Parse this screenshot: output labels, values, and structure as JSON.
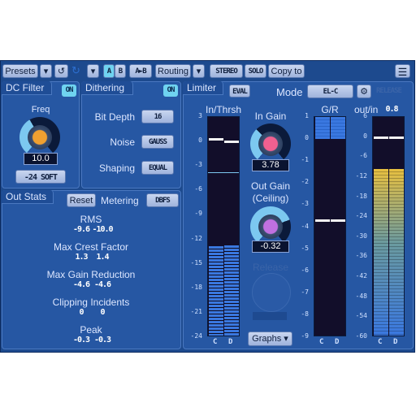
{
  "toolbar": {
    "presets": "Presets",
    "a": "A",
    "b": "B",
    "ab": "A►B",
    "routing": "Routing",
    "stereo": "STEREO",
    "solo": "SOLO",
    "copy_to": "Copy to"
  },
  "dc_filter": {
    "title": "DC Filter",
    "on": "ON",
    "freq_label": "Freq",
    "freq_value": "10.0",
    "slope": "-24 SOFT"
  },
  "dithering": {
    "title": "Dithering",
    "on": "ON",
    "bit_depth_label": "Bit Depth",
    "bit_depth": "16",
    "noise_label": "Noise",
    "noise": "GAUSS",
    "shaping_label": "Shaping",
    "shaping": "EQUAL"
  },
  "limiter": {
    "title": "Limiter",
    "eval": "EVAL",
    "mode_label": "Mode",
    "mode": "EL-C",
    "release_btn": "RELEASE",
    "in_thrsh_label": "In/Thrsh",
    "gr_label": "G/R",
    "out_in_label": "out/in",
    "out_in_value": "0.8",
    "in_gain_label": "In Gain",
    "in_gain": "3.78",
    "out_gain_label": "Out Gain",
    "ceiling_label": "(Ceiling)",
    "out_gain": "-0.32",
    "release_label": "Release",
    "graphs": "Graphs ▾",
    "in_scale": [
      "3",
      "0",
      "-3",
      "-6",
      "-9",
      "-12",
      "-15",
      "-18",
      "-21",
      "-24"
    ],
    "gr_scale": [
      "1",
      "0",
      "-1",
      "-2",
      "-3",
      "-4",
      "-5",
      "-6",
      "-7",
      "-8",
      "-9"
    ],
    "out_scale": [
      "6",
      "0",
      "-6",
      "-12",
      "-18",
      "-24",
      "-30",
      "-36",
      "-42",
      "-48",
      "-54",
      "-60"
    ],
    "channels": [
      "C",
      "D"
    ],
    "in_meter": {
      "range": [
        -24,
        3
      ],
      "levels": [
        -12.8,
        -12.7
      ],
      "peaks": [
        0.3,
        0
      ],
      "threshold": -3.8
    },
    "gr_meter": {
      "range": [
        -9,
        1
      ],
      "fill_from_top_to": 0,
      "peaks": [
        -3.7,
        -3.7
      ]
    },
    "out_meter": {
      "range": [
        -60,
        6
      ],
      "levels": [
        -9.5,
        -9.5
      ],
      "peaks": [
        0,
        0
      ]
    },
    "in_gain_knob": 0.35,
    "out_gain_knob": 0.75,
    "freq_knob": 0.4
  },
  "out_stats": {
    "title": "Out Stats",
    "reset": "Reset",
    "metering_label": "Metering",
    "metering": "DBFS",
    "items": [
      {
        "label": "RMS",
        "l": "-9.6",
        "r": "-10.0"
      },
      {
        "label": "Max Crest Factor",
        "l": "1.3",
        "r": "1.4"
      },
      {
        "label": "Max Gain Reduction",
        "l": "-4.6",
        "r": "-4.6"
      },
      {
        "label": "Clipping Incidents",
        "l": "0",
        "r": "0"
      },
      {
        "label": "Peak",
        "l": "-0.3",
        "r": "-0.3"
      }
    ]
  },
  "colors": {
    "bg": "#1d4a8e",
    "panel": "#2657a3",
    "on": "#6fd3f0",
    "meter_blue": "#3a78e0",
    "meter_yellow": "#e8c040"
  }
}
